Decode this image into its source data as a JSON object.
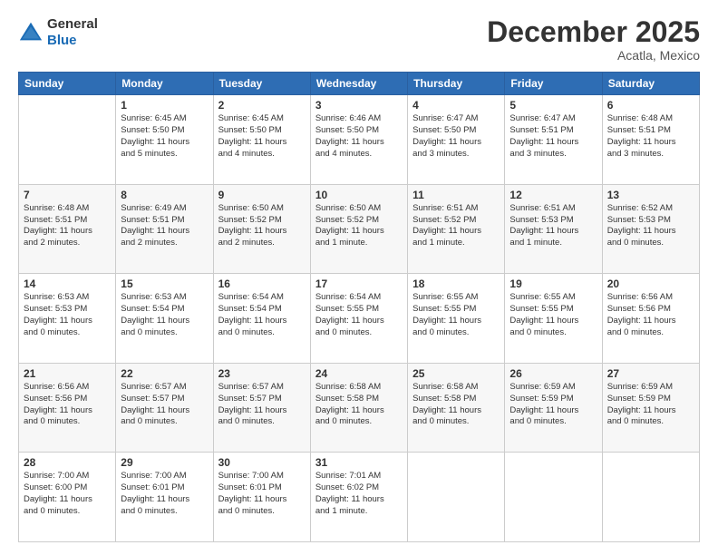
{
  "header": {
    "logo_line1": "General",
    "logo_line2": "Blue",
    "month": "December 2025",
    "location": "Acatla, Mexico"
  },
  "days_of_week": [
    "Sunday",
    "Monday",
    "Tuesday",
    "Wednesday",
    "Thursday",
    "Friday",
    "Saturday"
  ],
  "weeks": [
    [
      {
        "day": "",
        "text": ""
      },
      {
        "day": "1",
        "text": "Sunrise: 6:45 AM\nSunset: 5:50 PM\nDaylight: 11 hours\nand 5 minutes."
      },
      {
        "day": "2",
        "text": "Sunrise: 6:45 AM\nSunset: 5:50 PM\nDaylight: 11 hours\nand 4 minutes."
      },
      {
        "day": "3",
        "text": "Sunrise: 6:46 AM\nSunset: 5:50 PM\nDaylight: 11 hours\nand 4 minutes."
      },
      {
        "day": "4",
        "text": "Sunrise: 6:47 AM\nSunset: 5:50 PM\nDaylight: 11 hours\nand 3 minutes."
      },
      {
        "day": "5",
        "text": "Sunrise: 6:47 AM\nSunset: 5:51 PM\nDaylight: 11 hours\nand 3 minutes."
      },
      {
        "day": "6",
        "text": "Sunrise: 6:48 AM\nSunset: 5:51 PM\nDaylight: 11 hours\nand 3 minutes."
      }
    ],
    [
      {
        "day": "7",
        "text": "Sunrise: 6:48 AM\nSunset: 5:51 PM\nDaylight: 11 hours\nand 2 minutes."
      },
      {
        "day": "8",
        "text": "Sunrise: 6:49 AM\nSunset: 5:51 PM\nDaylight: 11 hours\nand 2 minutes."
      },
      {
        "day": "9",
        "text": "Sunrise: 6:50 AM\nSunset: 5:52 PM\nDaylight: 11 hours\nand 2 minutes."
      },
      {
        "day": "10",
        "text": "Sunrise: 6:50 AM\nSunset: 5:52 PM\nDaylight: 11 hours\nand 1 minute."
      },
      {
        "day": "11",
        "text": "Sunrise: 6:51 AM\nSunset: 5:52 PM\nDaylight: 11 hours\nand 1 minute."
      },
      {
        "day": "12",
        "text": "Sunrise: 6:51 AM\nSunset: 5:53 PM\nDaylight: 11 hours\nand 1 minute."
      },
      {
        "day": "13",
        "text": "Sunrise: 6:52 AM\nSunset: 5:53 PM\nDaylight: 11 hours\nand 0 minutes."
      }
    ],
    [
      {
        "day": "14",
        "text": "Sunrise: 6:53 AM\nSunset: 5:53 PM\nDaylight: 11 hours\nand 0 minutes."
      },
      {
        "day": "15",
        "text": "Sunrise: 6:53 AM\nSunset: 5:54 PM\nDaylight: 11 hours\nand 0 minutes."
      },
      {
        "day": "16",
        "text": "Sunrise: 6:54 AM\nSunset: 5:54 PM\nDaylight: 11 hours\nand 0 minutes."
      },
      {
        "day": "17",
        "text": "Sunrise: 6:54 AM\nSunset: 5:55 PM\nDaylight: 11 hours\nand 0 minutes."
      },
      {
        "day": "18",
        "text": "Sunrise: 6:55 AM\nSunset: 5:55 PM\nDaylight: 11 hours\nand 0 minutes."
      },
      {
        "day": "19",
        "text": "Sunrise: 6:55 AM\nSunset: 5:55 PM\nDaylight: 11 hours\nand 0 minutes."
      },
      {
        "day": "20",
        "text": "Sunrise: 6:56 AM\nSunset: 5:56 PM\nDaylight: 11 hours\nand 0 minutes."
      }
    ],
    [
      {
        "day": "21",
        "text": "Sunrise: 6:56 AM\nSunset: 5:56 PM\nDaylight: 11 hours\nand 0 minutes."
      },
      {
        "day": "22",
        "text": "Sunrise: 6:57 AM\nSunset: 5:57 PM\nDaylight: 11 hours\nand 0 minutes."
      },
      {
        "day": "23",
        "text": "Sunrise: 6:57 AM\nSunset: 5:57 PM\nDaylight: 11 hours\nand 0 minutes."
      },
      {
        "day": "24",
        "text": "Sunrise: 6:58 AM\nSunset: 5:58 PM\nDaylight: 11 hours\nand 0 minutes."
      },
      {
        "day": "25",
        "text": "Sunrise: 6:58 AM\nSunset: 5:58 PM\nDaylight: 11 hours\nand 0 minutes."
      },
      {
        "day": "26",
        "text": "Sunrise: 6:59 AM\nSunset: 5:59 PM\nDaylight: 11 hours\nand 0 minutes."
      },
      {
        "day": "27",
        "text": "Sunrise: 6:59 AM\nSunset: 5:59 PM\nDaylight: 11 hours\nand 0 minutes."
      }
    ],
    [
      {
        "day": "28",
        "text": "Sunrise: 7:00 AM\nSunset: 6:00 PM\nDaylight: 11 hours\nand 0 minutes."
      },
      {
        "day": "29",
        "text": "Sunrise: 7:00 AM\nSunset: 6:01 PM\nDaylight: 11 hours\nand 0 minutes."
      },
      {
        "day": "30",
        "text": "Sunrise: 7:00 AM\nSunset: 6:01 PM\nDaylight: 11 hours\nand 0 minutes."
      },
      {
        "day": "31",
        "text": "Sunrise: 7:01 AM\nSunset: 6:02 PM\nDaylight: 11 hours\nand 1 minute."
      },
      {
        "day": "",
        "text": ""
      },
      {
        "day": "",
        "text": ""
      },
      {
        "day": "",
        "text": ""
      }
    ]
  ]
}
